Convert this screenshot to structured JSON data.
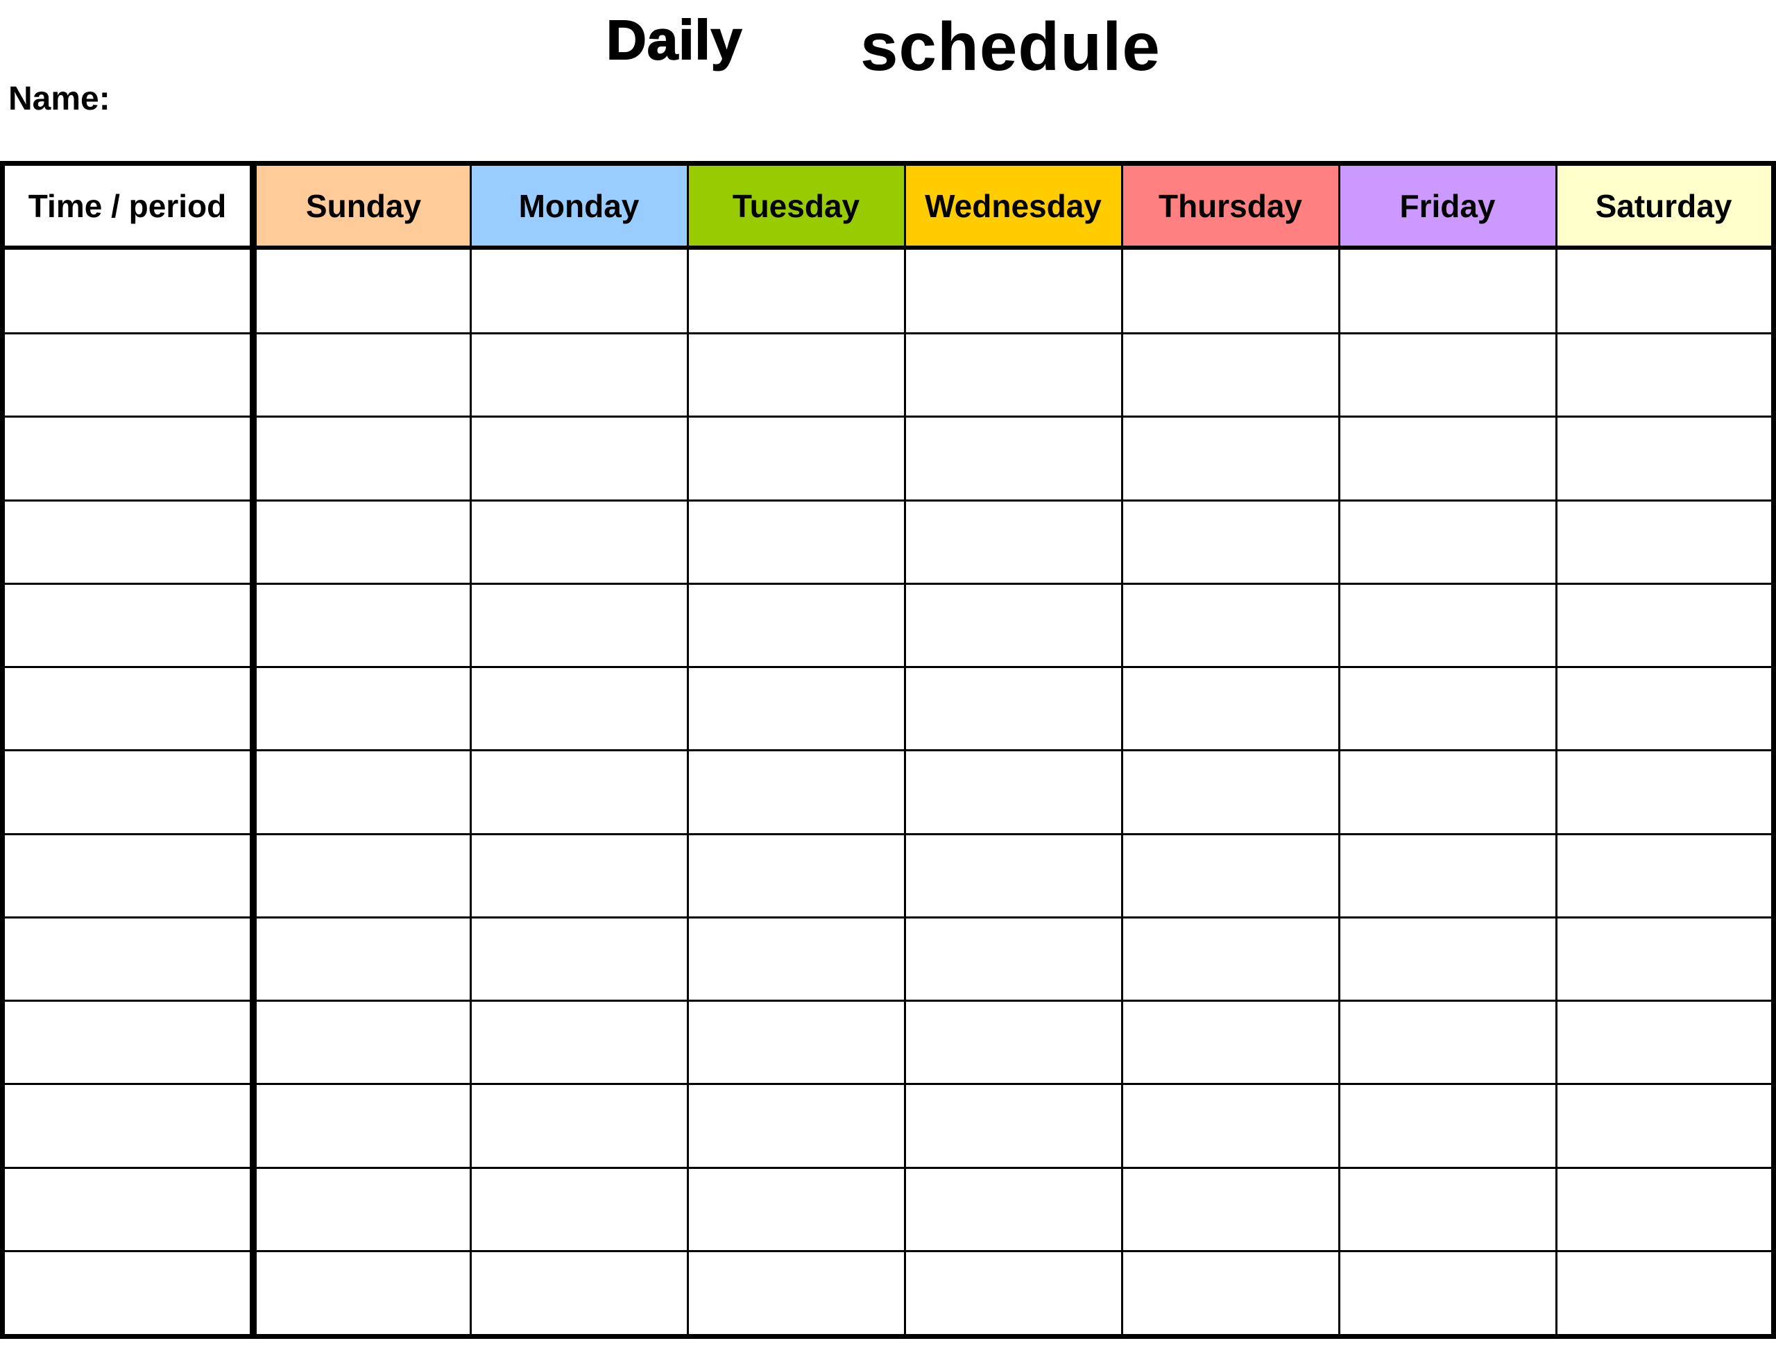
{
  "document": {
    "title_word_1": "Daily",
    "title_word_2": "schedule",
    "name_label": "Name:",
    "name_value": ""
  },
  "table": {
    "first_column_header": "Time / period",
    "days": [
      {
        "label": "Sunday",
        "color": "#FFCC99"
      },
      {
        "label": "Monday",
        "color": "#99CCFF"
      },
      {
        "label": "Tuesday",
        "color": "#99CC00"
      },
      {
        "label": "Wednesday",
        "color": "#FFCC00"
      },
      {
        "label": "Thursday",
        "color": "#FF8080"
      },
      {
        "label": "Friday",
        "color": "#CC99FF"
      },
      {
        "label": "Saturday",
        "color": "#FFFFCC"
      }
    ],
    "row_count": 13,
    "rows": [
      {
        "time": "",
        "cells": [
          "",
          "",
          "",
          "",
          "",
          "",
          ""
        ]
      },
      {
        "time": "",
        "cells": [
          "",
          "",
          "",
          "",
          "",
          "",
          ""
        ]
      },
      {
        "time": "",
        "cells": [
          "",
          "",
          "",
          "",
          "",
          "",
          ""
        ]
      },
      {
        "time": "",
        "cells": [
          "",
          "",
          "",
          "",
          "",
          "",
          ""
        ]
      },
      {
        "time": "",
        "cells": [
          "",
          "",
          "",
          "",
          "",
          "",
          ""
        ]
      },
      {
        "time": "",
        "cells": [
          "",
          "",
          "",
          "",
          "",
          "",
          ""
        ]
      },
      {
        "time": "",
        "cells": [
          "",
          "",
          "",
          "",
          "",
          "",
          ""
        ]
      },
      {
        "time": "",
        "cells": [
          "",
          "",
          "",
          "",
          "",
          "",
          ""
        ]
      },
      {
        "time": "",
        "cells": [
          "",
          "",
          "",
          "",
          "",
          "",
          ""
        ]
      },
      {
        "time": "",
        "cells": [
          "",
          "",
          "",
          "",
          "",
          "",
          ""
        ]
      },
      {
        "time": "",
        "cells": [
          "",
          "",
          "",
          "",
          "",
          "",
          ""
        ]
      },
      {
        "time": "",
        "cells": [
          "",
          "",
          "",
          "",
          "",
          "",
          ""
        ]
      },
      {
        "time": "",
        "cells": [
          "",
          "",
          "",
          "",
          "",
          "",
          ""
        ]
      }
    ]
  }
}
